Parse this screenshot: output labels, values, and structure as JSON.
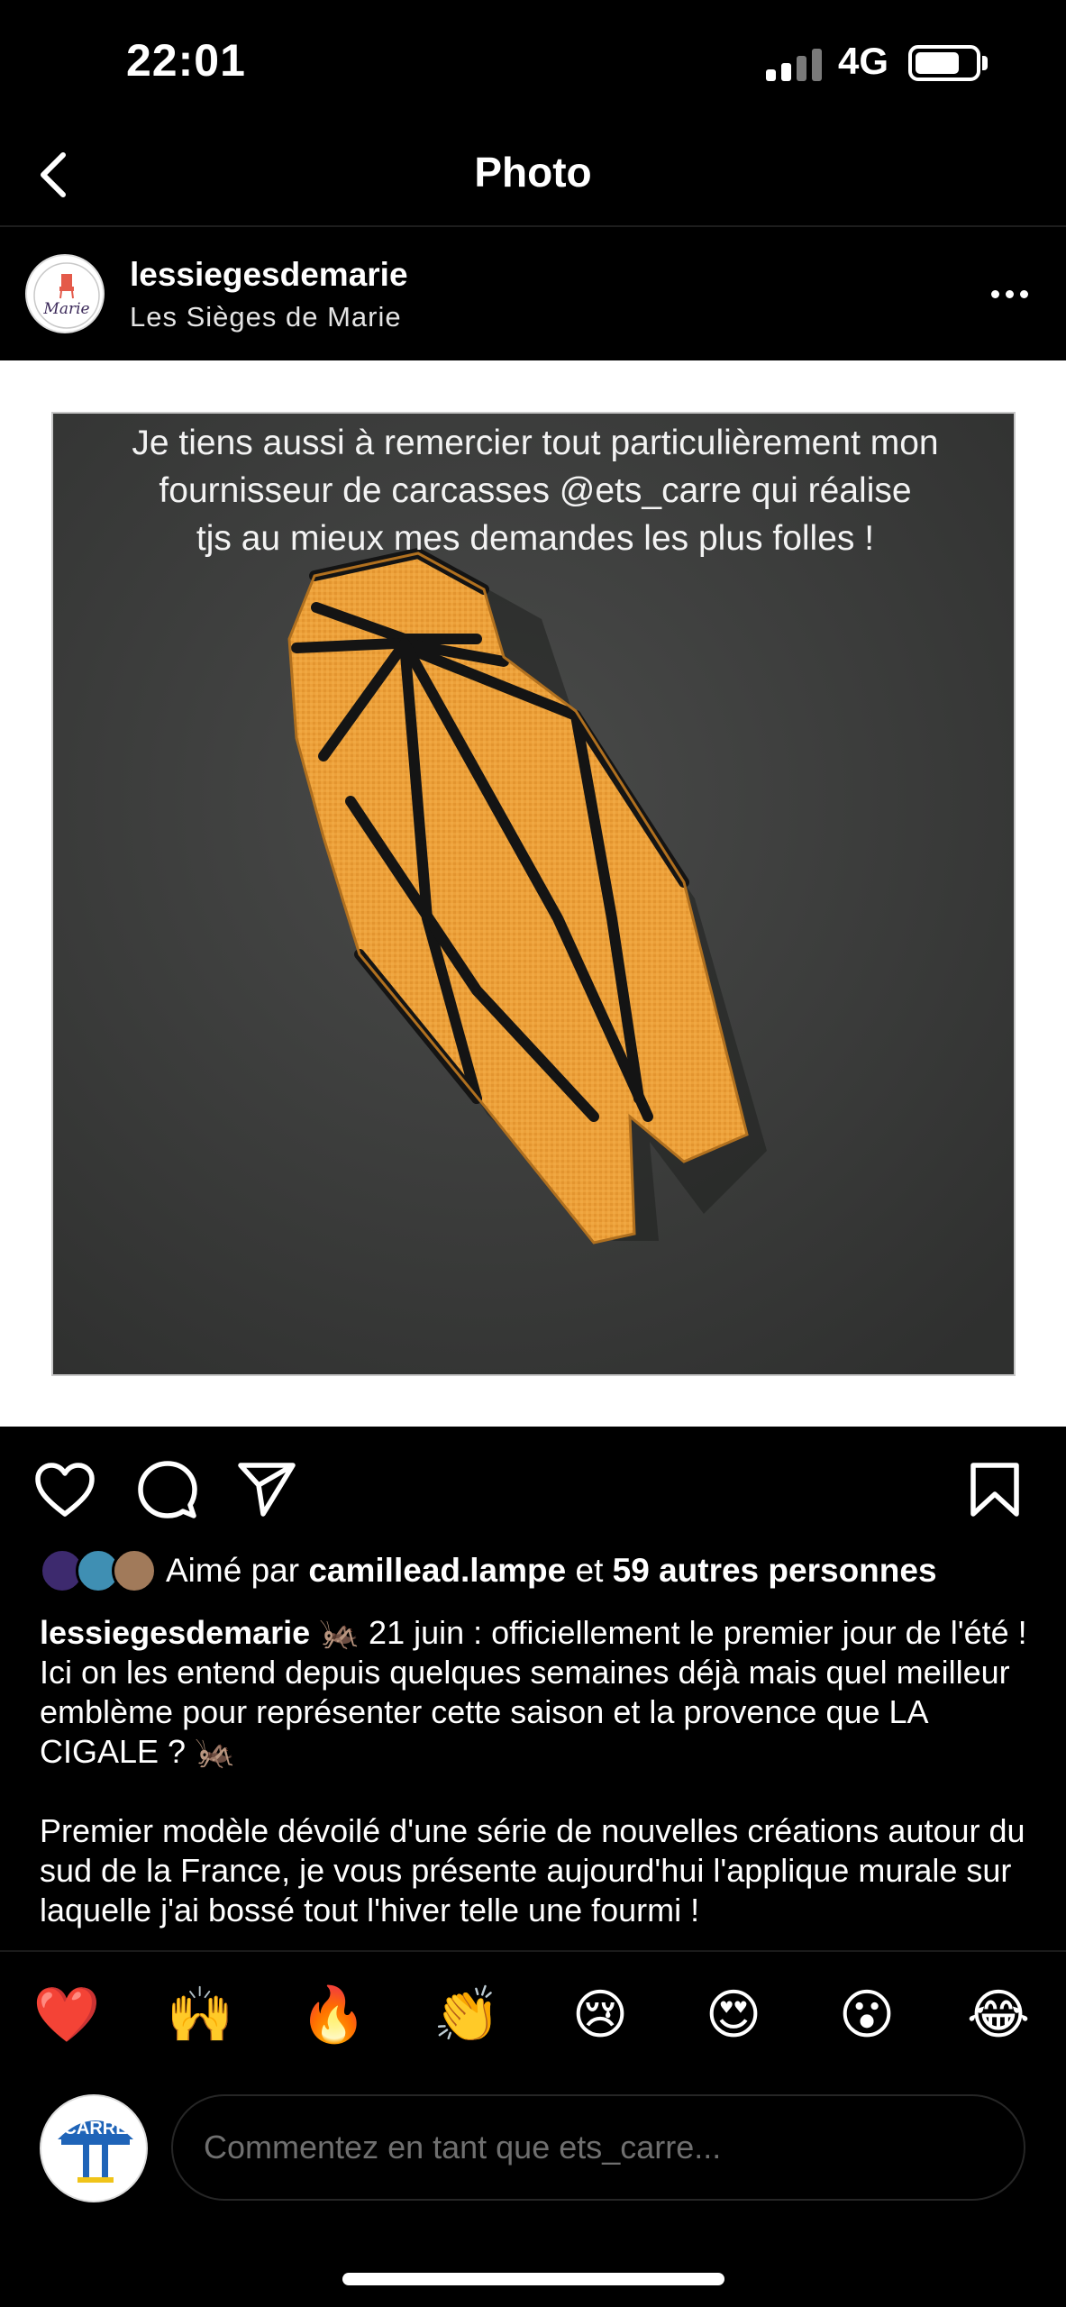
{
  "status_bar": {
    "time": "22:01",
    "network": "4G",
    "battery_percent": 75
  },
  "nav": {
    "title": "Photo"
  },
  "post": {
    "author": "lessiegesdemarie",
    "subtitle": "Les Sièges de Marie",
    "avatar_text": "Marie",
    "image_caption": [
      "Je tiens aussi à remercier tout particulièrement mon",
      "fournisseur de carcasses @ets_carre qui réalise",
      "tjs au mieux mes demandes les plus folles !"
    ],
    "liked_by_prefix": "Aimé par",
    "liked_by_user": "camillead.lampe",
    "liked_by_and": "et",
    "liked_by_others": "59 autres personnes",
    "caption_user": "lessiegesdemarie",
    "caption_p1": "🦗 21 juin : officiellement le premier jour de l'été ! Ici on les entend depuis quelques semaines déjà mais quel meilleur emblème pour représenter cette saison et la provence que LA CIGALE ? 🦗",
    "caption_p2": "Premier modèle dévoilé d'une série de nouvelles créations autour du sud de la France, je vous présente aujourd'hui l'applique murale sur laquelle j'ai bossé tout l'hiver telle une fourmi !"
  },
  "emoji_bar": [
    "❤️",
    "🙌",
    "🔥",
    "👏",
    "😢",
    "😍",
    "😮",
    "😂"
  ],
  "comment": {
    "placeholder": "Commentez en tant que ets_carre...",
    "avatar_text": "CARRE"
  },
  "colors": {
    "background": "#000000",
    "photo_wall": "#3b3c3b",
    "cicada_orange": "#eda13a",
    "cicada_stripe": "#141414"
  },
  "icons": {
    "back": "chevron-left-icon",
    "more": "more-horizontal-icon",
    "like": "heart-icon",
    "comment": "speech-bubble-icon",
    "share": "paper-plane-icon",
    "save": "bookmark-icon"
  }
}
